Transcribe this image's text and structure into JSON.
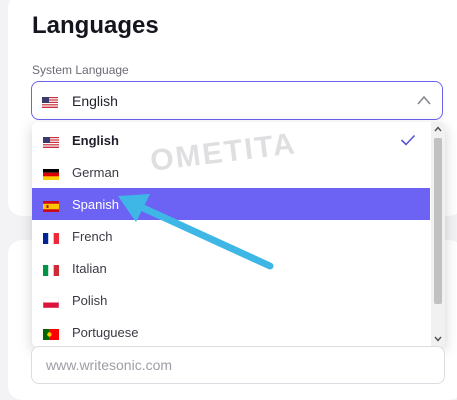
{
  "section": {
    "title": "Languages",
    "field_label": "System Language",
    "selected_value": "English",
    "selected_flag": "us-flag-icon"
  },
  "dropdown": {
    "options": [
      {
        "label": "English",
        "flag": "us-flag-icon",
        "selected": true
      },
      {
        "label": "German",
        "flag": "germany-flag-icon"
      },
      {
        "label": "Spanish",
        "flag": "spain-flag-icon",
        "highlighted": true
      },
      {
        "label": "French",
        "flag": "france-flag-icon"
      },
      {
        "label": "Italian",
        "flag": "italy-flag-icon"
      },
      {
        "label": "Polish",
        "flag": "poland-flag-icon"
      },
      {
        "label": "Portuguese",
        "flag": "portugal-flag-icon"
      }
    ],
    "checkmark_icon": "check-icon"
  },
  "website_input": {
    "placeholder": "www.writesonic.com"
  },
  "watermark": {
    "text": "OMETITA"
  },
  "colors": {
    "accent": "#6c63f5",
    "border_focus": "#6b63f0",
    "annotation_arrow": "#3fb7e6"
  }
}
